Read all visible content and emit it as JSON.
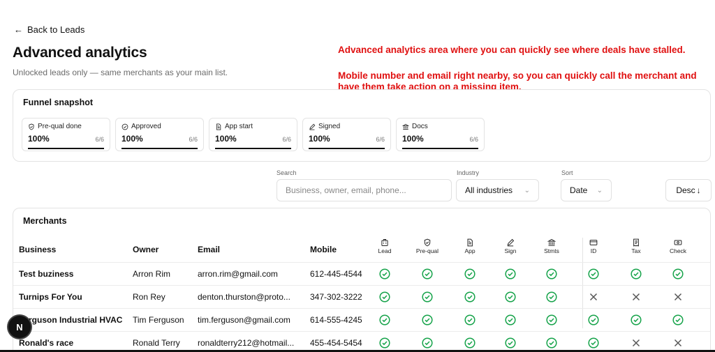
{
  "nav": {
    "back_label": "Back to Leads"
  },
  "page": {
    "title": "Advanced analytics",
    "subtitle": "Unlocked leads only — same merchants as your main list."
  },
  "annotations": {
    "line1": "Advanced analytics area where you can quickly see where deals have stalled.",
    "line2": "Mobile number and email right nearby, so you can quickly call the merchant and have them take action on a missing item."
  },
  "funnel": {
    "title": "Funnel snapshot",
    "steps": [
      {
        "label": "Pre-qual done",
        "icon": "shield-check-icon",
        "percent": "100%",
        "fraction": "6/6",
        "progress": 1.0
      },
      {
        "label": "Approved",
        "icon": "check-circle-icon",
        "percent": "100%",
        "fraction": "6/6",
        "progress": 1.0
      },
      {
        "label": "App start",
        "icon": "document-icon",
        "percent": "100%",
        "fraction": "6/6",
        "progress": 1.0
      },
      {
        "label": "Signed",
        "icon": "pen-icon",
        "percent": "100%",
        "fraction": "6/6",
        "progress": 1.0
      },
      {
        "label": "Docs",
        "icon": "bank-icon",
        "percent": "100%",
        "fraction": "6/6",
        "progress": 1.0
      }
    ]
  },
  "filters": {
    "search_label": "Search",
    "search_placeholder": "Business, owner, email, phone...",
    "industry_label": "Industry",
    "industry_value": "All industries",
    "sort_label": "Sort",
    "sort_value": "Date",
    "order_value": "Desc"
  },
  "merchants": {
    "title": "Merchants",
    "columns": {
      "business": "Business",
      "owner": "Owner",
      "email": "Email",
      "mobile": "Mobile"
    },
    "status_columns": [
      {
        "label": "Lead",
        "icon": "building-icon"
      },
      {
        "label": "Pre-qual",
        "icon": "shield-check-icon"
      },
      {
        "label": "App",
        "icon": "document-icon"
      },
      {
        "label": "Sign",
        "icon": "pen-icon"
      },
      {
        "label": "Stmts",
        "icon": "bank-icon"
      },
      {
        "label": "ID",
        "icon": "card-icon"
      },
      {
        "label": "Tax",
        "icon": "receipt-icon"
      },
      {
        "label": "Check",
        "icon": "cash-icon"
      }
    ],
    "rows": [
      {
        "business": "Test buziness",
        "owner": "Arron Rim",
        "email": "arron.rim@gmail.com",
        "mobile": "612-445-4544",
        "status": [
          true,
          true,
          true,
          true,
          true,
          true,
          true,
          true
        ]
      },
      {
        "business": "Turnips For You",
        "owner": "Ron Rey",
        "email": "denton.thurston@proto...",
        "mobile": "347-302-3222",
        "status": [
          true,
          true,
          true,
          true,
          true,
          false,
          false,
          false
        ]
      },
      {
        "business": "Ferguson Industrial HVAC",
        "owner": "Tim Ferguson",
        "email": "tim.ferguson@gmail.com",
        "mobile": "614-555-4245",
        "status": [
          true,
          true,
          true,
          true,
          true,
          true,
          true,
          true
        ]
      },
      {
        "business": "Ronald's race",
        "owner": "Ronald Terry",
        "email": "ronaldterry212@hotmail...",
        "mobile": "455-454-5454",
        "status": [
          true,
          true,
          true,
          true,
          true,
          true,
          false,
          false
        ]
      }
    ]
  },
  "badge": {
    "letter": "N"
  },
  "colors": {
    "check": "#16a34a",
    "cross": "#555555",
    "annotation": "#e01010"
  }
}
